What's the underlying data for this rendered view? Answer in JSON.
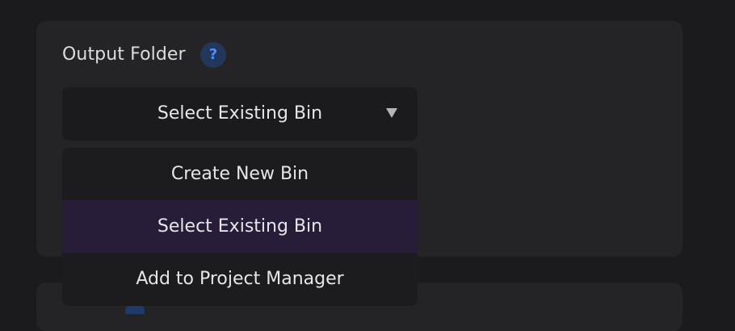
{
  "output_folder": {
    "label": "Output Folder",
    "help_glyph": "?",
    "help_icon": "question-mark-icon",
    "select": {
      "value": "Select Existing Bin",
      "chevron_icon": "chevron-down-icon"
    },
    "menu": {
      "items": [
        {
          "label": "Create New Bin",
          "selected": false
        },
        {
          "label": "Select Existing Bin",
          "selected": true
        },
        {
          "label": "Add to Project Manager",
          "selected": false
        }
      ]
    }
  },
  "colors": {
    "background": "#1b1b1e",
    "panel": "#242427",
    "accent_blue": "#4f8dff",
    "selected_item": "#271d38"
  }
}
